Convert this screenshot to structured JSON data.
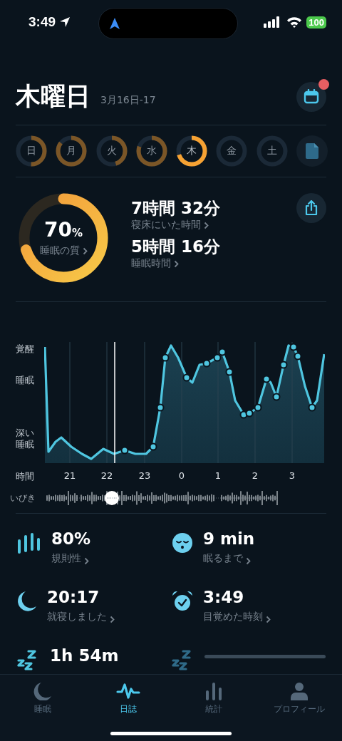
{
  "status_bar": {
    "time": "3:49",
    "battery": "100"
  },
  "header": {
    "title": "木曜日",
    "date_range": "3月16日-17",
    "calendar_badge": true
  },
  "week": [
    {
      "label": "日",
      "level": 0.5,
      "selected": false
    },
    {
      "label": "月",
      "level": 0.85,
      "selected": false
    },
    {
      "label": "火",
      "level": 0.45,
      "selected": false
    },
    {
      "label": "水",
      "level": 0.8,
      "selected": false
    },
    {
      "label": "木",
      "level": 0.7,
      "selected": true
    },
    {
      "label": "金",
      "selected": false
    },
    {
      "label": "土",
      "selected": false
    }
  ],
  "summary": {
    "quality": {
      "value": "70",
      "unit": "%",
      "label": "睡眠の質",
      "level": 0.7
    },
    "stats": [
      {
        "value": "7時間 32分",
        "label": "寝床にいた時間"
      },
      {
        "value": "5時間 16分",
        "label": "睡眠時間"
      }
    ]
  },
  "chart": {
    "y_labels": [
      "覚醒",
      "睡眠",
      "深い睡眠"
    ],
    "x_axis_label": "時間",
    "x_labels": [
      "21",
      "22",
      "23",
      "0",
      "1",
      "2",
      "3"
    ],
    "snore_label": "いびき"
  },
  "metrics": [
    {
      "kind": "regularity",
      "value": "80%",
      "label": "規則性"
    },
    {
      "kind": "latency",
      "value": "9 min",
      "label": "眠るまで"
    },
    {
      "kind": "bedtime",
      "value": "20:17",
      "label": "就寝しました"
    },
    {
      "kind": "wake",
      "value": "3:49",
      "label": "目覚めた時刻"
    },
    {
      "kind": "snore",
      "value": "1h 54m"
    },
    {
      "kind": "pending"
    }
  ],
  "tabs": [
    {
      "kind": "sleep",
      "label": "睡眠",
      "selected": false
    },
    {
      "kind": "journal",
      "label": "日誌",
      "selected": true
    },
    {
      "kind": "stats",
      "label": "統計",
      "selected": false
    },
    {
      "kind": "profile",
      "label": "プロフィール",
      "selected": false
    }
  ]
}
